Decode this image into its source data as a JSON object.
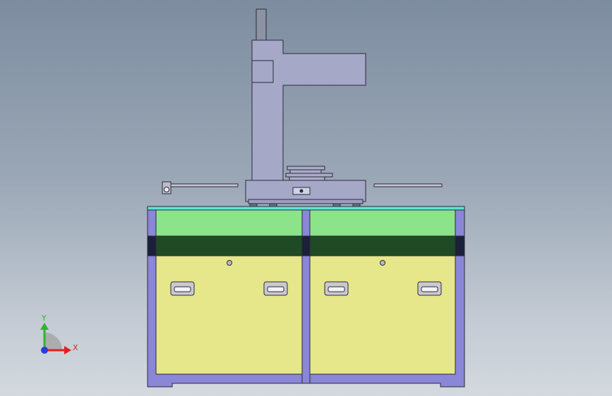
{
  "viewport": {
    "background_top": "#7d8da0",
    "background_bottom": "#d4d9df"
  },
  "colors": {
    "column": "#a6a8c8",
    "column_outline": "#2a2a3a",
    "frame": "#8a86d8",
    "worktop": "#5fe3d3",
    "upper_panel": "#8be48a",
    "dark_band": "#1f4a24",
    "drawer": "#e6e68a",
    "handle": "#c9c9cf"
  },
  "triad": {
    "y_label": "Y",
    "x_label": "X",
    "y_axis_color": "#2fb32f",
    "x_axis_color": "#e02020",
    "origin_color": "#2a3be0"
  },
  "parts": [
    "post",
    "column",
    "head-arm",
    "column-bracket",
    "base-block",
    "left-rail",
    "right-rail",
    "fixture",
    "worktop",
    "cabinet-frame",
    "upper-panel-left",
    "upper-panel-right",
    "dark-band",
    "drawer-left",
    "drawer-right"
  ]
}
